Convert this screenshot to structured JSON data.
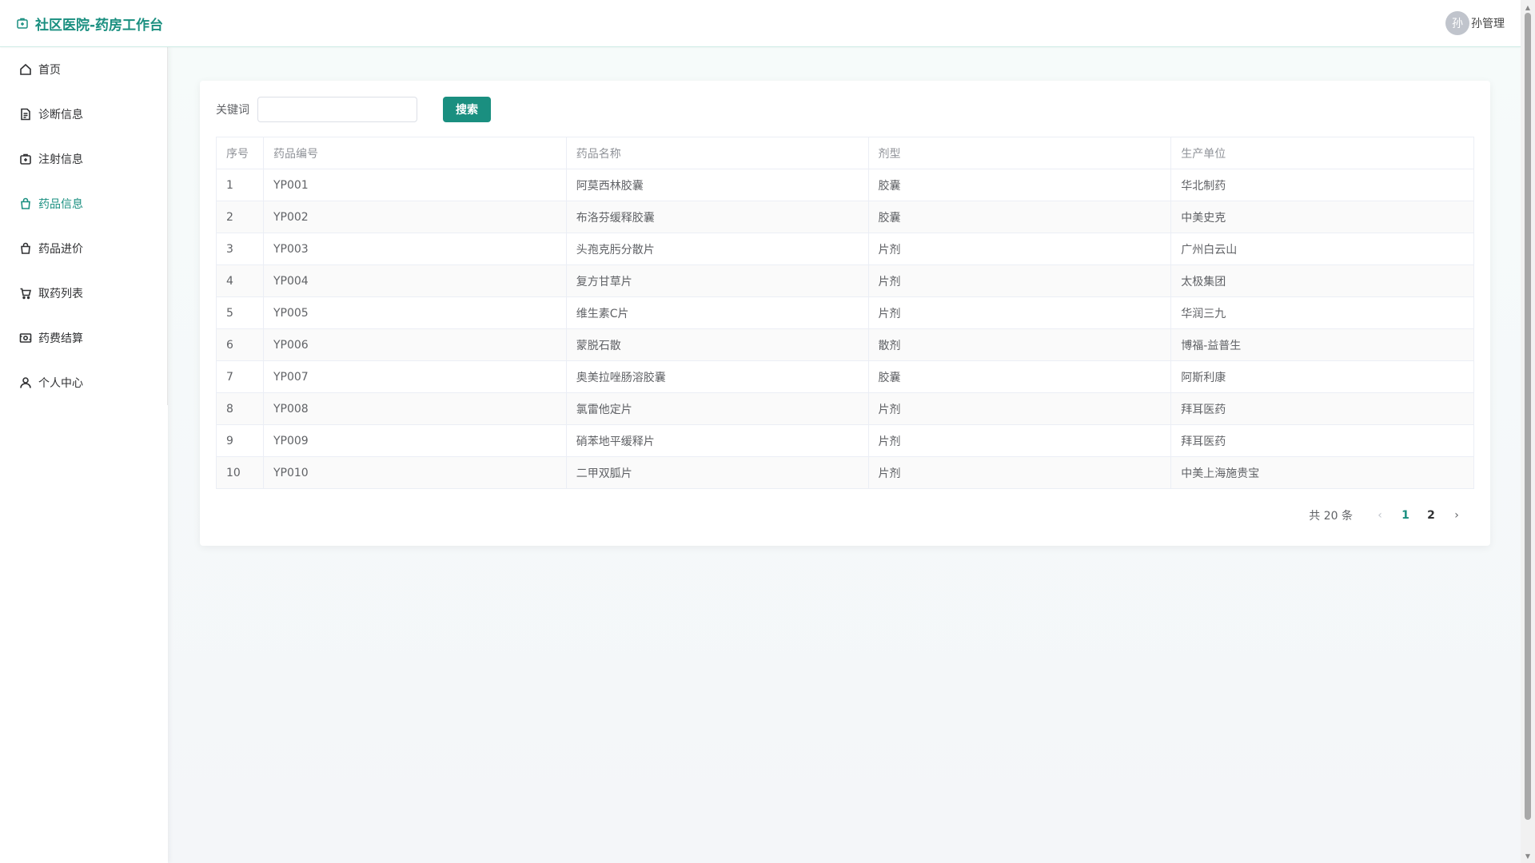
{
  "header": {
    "title": "社区医院-药房工作台",
    "user": {
      "avatar_text": "孙",
      "name": "孙管理"
    }
  },
  "sidebar": {
    "items": [
      {
        "label": "首页",
        "icon": "home-icon"
      },
      {
        "label": "诊断信息",
        "icon": "document-icon"
      },
      {
        "label": "注射信息",
        "icon": "first-aid-icon"
      },
      {
        "label": "药品信息",
        "icon": "bag-icon",
        "active": true
      },
      {
        "label": "药品进价",
        "icon": "bag-icon"
      },
      {
        "label": "取药列表",
        "icon": "cart-icon"
      },
      {
        "label": "药费结算",
        "icon": "wallet-icon"
      },
      {
        "label": "个人中心",
        "icon": "user-icon"
      }
    ]
  },
  "search": {
    "label": "关键词",
    "value": "",
    "placeholder": "",
    "button_label": "搜索"
  },
  "table": {
    "headers": [
      "序号",
      "药品编号",
      "药品名称",
      "剂型",
      "生产单位"
    ],
    "rows": [
      [
        "1",
        "YP001",
        "阿莫西林胶囊",
        "胶囊",
        "华北制药"
      ],
      [
        "2",
        "YP002",
        "布洛芬缓释胶囊",
        "胶囊",
        "中美史克"
      ],
      [
        "3",
        "YP003",
        "头孢克肟分散片",
        "片剂",
        "广州白云山"
      ],
      [
        "4",
        "YP004",
        "复方甘草片",
        "片剂",
        "太极集团"
      ],
      [
        "5",
        "YP005",
        "维生素C片",
        "片剂",
        "华润三九"
      ],
      [
        "6",
        "YP006",
        "蒙脱石散",
        "散剂",
        "博福-益普生"
      ],
      [
        "7",
        "YP007",
        "奥美拉唑肠溶胶囊",
        "胶囊",
        "阿斯利康"
      ],
      [
        "8",
        "YP008",
        "氯雷他定片",
        "片剂",
        "拜耳医药"
      ],
      [
        "9",
        "YP009",
        "硝苯地平缓释片",
        "片剂",
        "拜耳医药"
      ],
      [
        "10",
        "YP010",
        "二甲双胍片",
        "片剂",
        "中美上海施贵宝"
      ]
    ]
  },
  "pagination": {
    "total_text": "共 20 条",
    "pages": [
      "1",
      "2"
    ],
    "current": "1",
    "prev_glyph": "‹",
    "next_glyph": "›"
  },
  "colors": {
    "accent": "#1a8f80",
    "header_border": "#cfece6",
    "table_border": "#ebeef5"
  }
}
